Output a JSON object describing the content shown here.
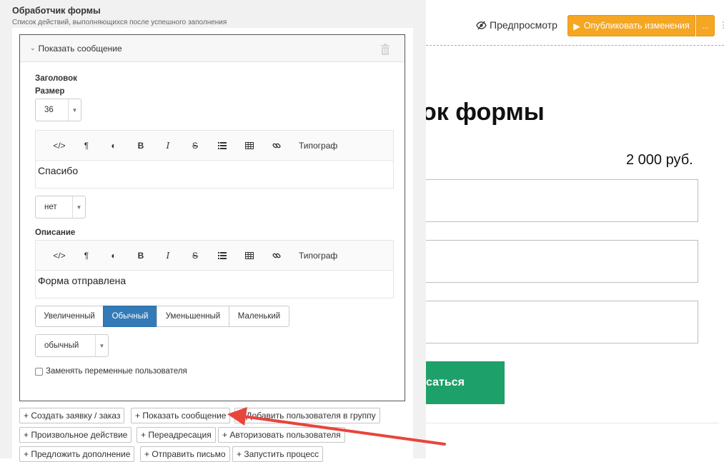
{
  "topbar": {
    "preview_label": "Предпросмотр",
    "publish_label": "Опубликовать изменения",
    "more_label": "..."
  },
  "page": {
    "heading_fragment": "ок формы",
    "price": "2 000 руб.",
    "submit_fragment": "саться"
  },
  "panel": {
    "title": "Обработчик формы",
    "subtitle": "Список действий, выполняющихся после успешного заполнения",
    "action": {
      "header_label": "Показать сообщение",
      "heading_label": "Заголовок",
      "size_label": "Размер",
      "size_value": "36",
      "toolbar": {
        "typograph_label": "Типограф"
      },
      "heading_text": "Спасибо",
      "heading_option": "нет",
      "description_label": "Описание",
      "description_text": "Форма отправлена",
      "size_options": [
        "Увеличенный",
        "Обычный",
        "Уменьшенный",
        "Маленький"
      ],
      "active_size": "Обычный",
      "style_value": "обычный",
      "replace_vars_label": "Заменять переменные пользователя"
    },
    "add_buttons": [
      "+ Создать заявку / заказ",
      "+ Показать сообщение",
      "+ Добавить пользователя в группу",
      "+ Произвольное действие",
      "+ Переадресация",
      "+ Авторизовать пользователя",
      "+ Предложить дополнение",
      "+ Отправить письмо",
      "+ Запустить процесс"
    ]
  },
  "colors": {
    "publish": "#f5a623",
    "submit": "#1ea06a",
    "segment_active": "#337ab7",
    "annotation_arrow": "#e8453c"
  }
}
